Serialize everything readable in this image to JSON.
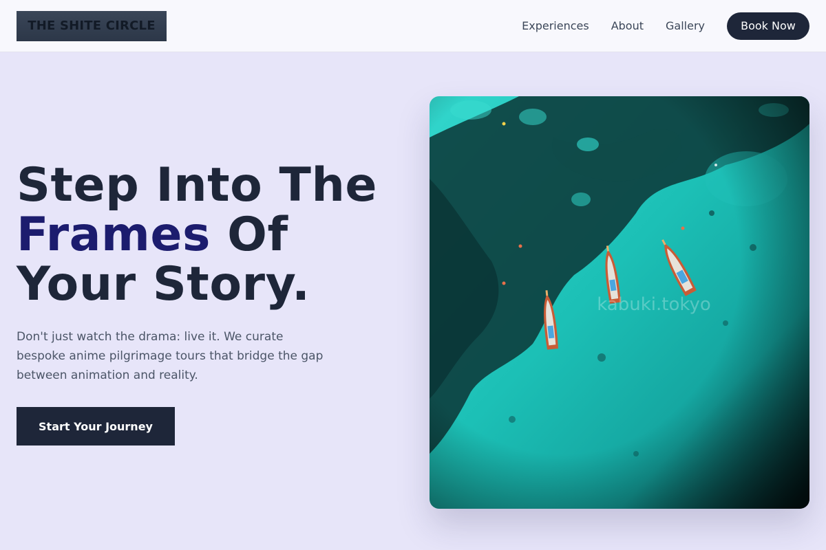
{
  "brand": {
    "logo_text": "THE SHITE CIRCLE"
  },
  "nav": {
    "links": [
      {
        "label": "Experiences"
      },
      {
        "label": "About"
      },
      {
        "label": "Gallery"
      }
    ],
    "cta_label": "Book Now"
  },
  "hero": {
    "headline_line1": "Step Into The",
    "headline_accent": "Frames",
    "headline_line2_rest": " Of",
    "headline_line3": "Your Story.",
    "subtext": "Don't just watch the drama: live it. We curate bespoke anime pilgrimage tours that bridge the gap between animation and reality.",
    "cta_label": "Start Your Journey",
    "image": {
      "description_icon": "aerial-boats-photo",
      "watermark": "kabuki.tokyo"
    }
  },
  "colors": {
    "background": "#e7e5f9",
    "navbar": "#f8f8fd",
    "dark": "#1e2639",
    "accent": "#1c1c6e",
    "body_text": "#4b5567",
    "water": "#1fc4bd"
  }
}
